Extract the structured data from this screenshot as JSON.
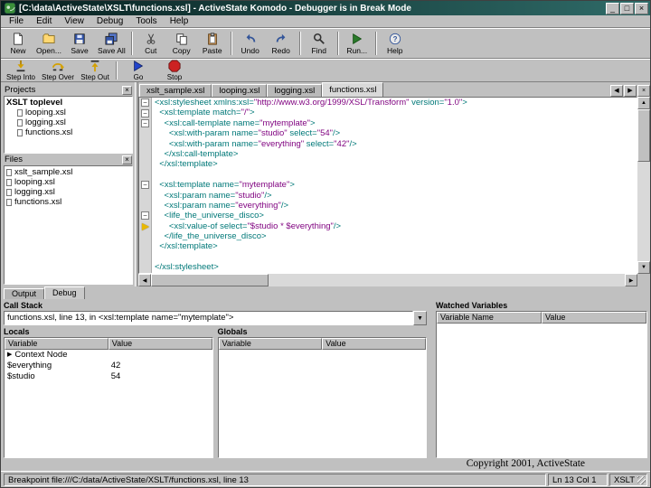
{
  "window": {
    "title": "[C:\\data\\ActiveState\\XSLT\\functions.xsl] - ActiveState Komodo - Debugger is in Break Mode"
  },
  "icons": {
    "minimize": "_",
    "maximize": "□",
    "close": "×",
    "panel_close": "×",
    "tab_scroll_left": "◀",
    "tab_scroll_right": "▶",
    "tab_close": "×",
    "scroll_up": "▲",
    "scroll_down": "▼",
    "scroll_left": "◀",
    "scroll_right": "▶",
    "combo_arrow": "▼",
    "expand": "▶",
    "fold_collapse": "−"
  },
  "menubar": {
    "items": [
      "File",
      "Edit",
      "View",
      "Debug",
      "Tools",
      "Help"
    ]
  },
  "toolbar_main": {
    "buttons": [
      {
        "label": "New"
      },
      {
        "label": "Open..."
      },
      {
        "label": "Save"
      },
      {
        "label": "Save All"
      },
      {
        "label": "Cut"
      },
      {
        "label": "Copy"
      },
      {
        "label": "Paste"
      },
      {
        "label": "Undo"
      },
      {
        "label": "Redo"
      },
      {
        "label": "Find"
      },
      {
        "label": "Run..."
      },
      {
        "label": "Help"
      }
    ]
  },
  "toolbar_debug": {
    "buttons": [
      {
        "label": "Step Into"
      },
      {
        "label": "Step Over"
      },
      {
        "label": "Step Out"
      },
      {
        "label": "Go"
      },
      {
        "label": "Stop"
      }
    ]
  },
  "projects_panel": {
    "title": "Projects",
    "project_name": "XSLT toplevel",
    "items": [
      "looping.xsl",
      "logging.xsl",
      "functions.xsl"
    ]
  },
  "files_panel": {
    "title": "Files",
    "items": [
      "xslt_sample.xsl",
      "looping.xsl",
      "logging.xsl",
      "functions.xsl"
    ]
  },
  "editor": {
    "tabs": [
      "xslt_sample.xsl",
      "looping.xsl",
      "logging.xsl",
      "functions.xsl"
    ],
    "active_tab": "functions.xsl",
    "lines": [
      {
        "fold": true,
        "tokens": [
          [
            "tag",
            "<xsl:stylesheet xmlns:xsl="
          ],
          [
            "str",
            "\"http://www.w3.org/1999/XSL/Transform\""
          ],
          [
            "tag",
            " version="
          ],
          [
            "str",
            "\"1.0\""
          ],
          [
            "tag",
            ">"
          ]
        ]
      },
      {
        "fold": true,
        "tokens": [
          [
            "tag",
            "  <xsl:template match="
          ],
          [
            "str",
            "\"/\""
          ],
          [
            "tag",
            ">"
          ]
        ]
      },
      {
        "fold": true,
        "tokens": [
          [
            "tag",
            "    <xsl:call-template name="
          ],
          [
            "str",
            "\"mytemplate\""
          ],
          [
            "tag",
            ">"
          ]
        ]
      },
      {
        "tokens": [
          [
            "tag",
            "      <xsl:with-param name="
          ],
          [
            "str",
            "\"studio\""
          ],
          [
            "tag",
            " select="
          ],
          [
            "str",
            "\"54\""
          ],
          [
            "tag",
            "/>"
          ]
        ]
      },
      {
        "tokens": [
          [
            "tag",
            "      <xsl:with-param name="
          ],
          [
            "str",
            "\"everything\""
          ],
          [
            "tag",
            " select="
          ],
          [
            "str",
            "\"42\""
          ],
          [
            "tag",
            "/>"
          ]
        ]
      },
      {
        "tokens": [
          [
            "tag",
            "    </xsl:call-template>"
          ]
        ]
      },
      {
        "tokens": [
          [
            "tag",
            "  </xsl:template>"
          ]
        ]
      },
      {
        "tokens": []
      },
      {
        "fold": true,
        "tokens": [
          [
            "tag",
            "  <xsl:template name="
          ],
          [
            "str",
            "\"mytemplate\""
          ],
          [
            "tag",
            ">"
          ]
        ]
      },
      {
        "tokens": [
          [
            "tag",
            "    <xsl:param name="
          ],
          [
            "str",
            "\"studio\""
          ],
          [
            "tag",
            "/>"
          ]
        ]
      },
      {
        "tokens": [
          [
            "tag",
            "    <xsl:param name="
          ],
          [
            "str",
            "\"everything\""
          ],
          [
            "tag",
            "/>"
          ]
        ]
      },
      {
        "fold": true,
        "tokens": [
          [
            "tag",
            "    <life_the_universe_disco>"
          ]
        ]
      },
      {
        "current": true,
        "tokens": [
          [
            "tag",
            "      <xsl:value-of select="
          ],
          [
            "str",
            "\"$studio * $everything\""
          ],
          [
            "tag",
            "/>"
          ]
        ]
      },
      {
        "tokens": [
          [
            "tag",
            "    </life_the_universe_disco>"
          ]
        ]
      },
      {
        "tokens": [
          [
            "tag",
            "  </xsl:template>"
          ]
        ]
      },
      {
        "tokens": []
      },
      {
        "tokens": [
          [
            "tag",
            "</xsl:stylesheet>"
          ]
        ]
      }
    ]
  },
  "bottom_pane": {
    "tabs": [
      "Output",
      "Debug"
    ],
    "call_stack": {
      "label": "Call Stack",
      "value": "functions.xsl, line 13, in <xsl:template name=\"mytemplate\">"
    },
    "locals": {
      "label": "Locals",
      "columns": [
        "Variable",
        "Value"
      ],
      "rows": [
        {
          "variable": "Context Node",
          "value": ""
        },
        {
          "variable": "$everything",
          "value": "42"
        },
        {
          "variable": "$studio",
          "value": "54"
        }
      ]
    },
    "globals": {
      "label": "Globals",
      "columns": [
        "Variable",
        "Value"
      ],
      "rows": []
    },
    "watched": {
      "label": "Watched Variables",
      "columns": [
        "Variable Name",
        "Value"
      ],
      "rows": []
    }
  },
  "copyright": "Copyright 2001, ActiveState",
  "statusbar": {
    "message": "Breakpoint file:///C:/data/ActiveState/XSLT/functions.xsl, line 13",
    "position": "Ln 13 Col 1",
    "language": "XSLT"
  },
  "colors": {
    "titlebar_teal": "#2f6b68",
    "code_tag": "#007878",
    "code_string": "#7f007f",
    "break_arrow": "#e8b800",
    "chrome_gray": "#c0c0c0"
  }
}
